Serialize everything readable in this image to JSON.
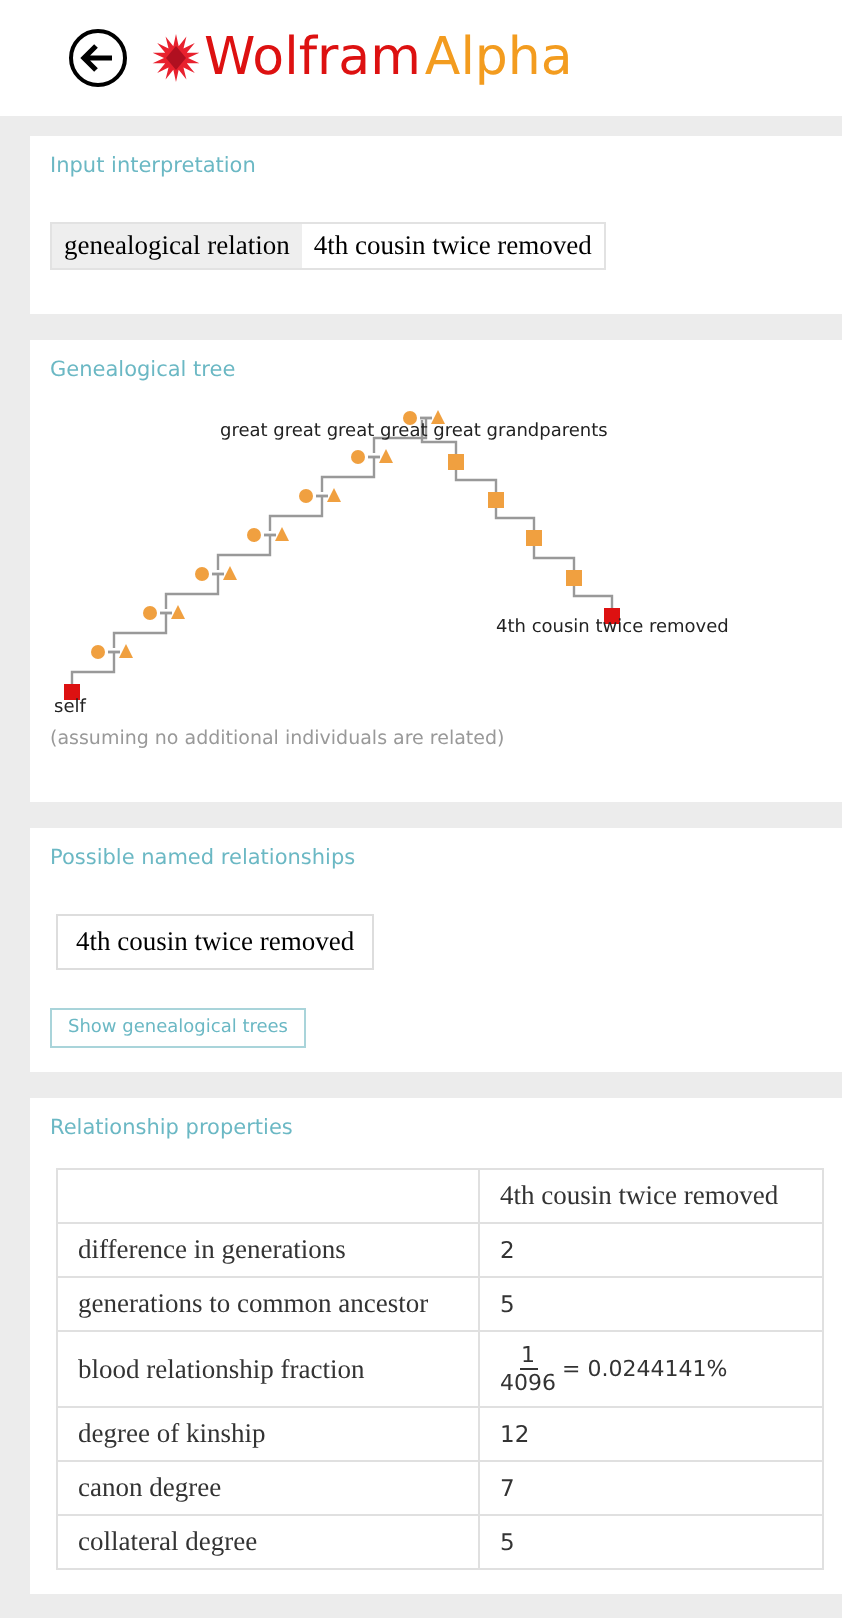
{
  "logo": {
    "first": "Wolfram",
    "second": "Alpha"
  },
  "interpretation": {
    "title": "Input interpretation",
    "label": "genealogical relation",
    "value": "4th cousin twice removed"
  },
  "tree": {
    "title": "Genealogical tree",
    "top_label": "great great great great great grandparents",
    "target_label": "4th cousin twice removed",
    "self_label": "self",
    "note": "(assuming no additional individuals are related)"
  },
  "named": {
    "title": "Possible named relationships",
    "items": [
      "4th cousin twice removed"
    ],
    "button": "Show genealogical trees"
  },
  "properties": {
    "title": "Relationship properties",
    "column": "4th cousin twice removed",
    "rows": [
      {
        "kind": "text",
        "label": "difference in generations",
        "value": "2"
      },
      {
        "kind": "text",
        "label": "generations to common ancestor",
        "value": "5"
      },
      {
        "kind": "fraction",
        "label": "blood relationship fraction",
        "numerator": "1",
        "denominator": "4096",
        "value": "= 0.0244141%"
      },
      {
        "kind": "text",
        "label": "degree of kinship",
        "value": "12"
      },
      {
        "kind": "text",
        "label": "canon degree",
        "value": "7"
      },
      {
        "kind": "text",
        "label": "collateral degree",
        "value": "5"
      }
    ]
  }
}
